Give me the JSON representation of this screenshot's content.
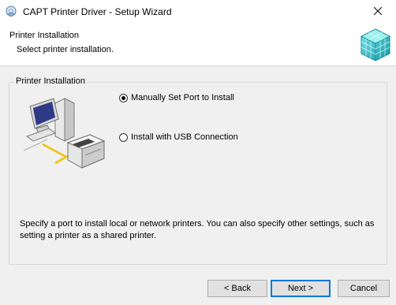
{
  "window": {
    "title": "CAPT Printer Driver - Setup Wizard",
    "title_icon": "setup-disc-icon",
    "close_icon": "close-icon"
  },
  "header": {
    "title": "Printer Installation",
    "subtitle": "Select printer installation.",
    "logo_icon": "cube-stack-logo-icon",
    "logo_color": "#1fb8c0"
  },
  "group": {
    "label": "Printer Installation",
    "illustration_icon": "computer-and-printer-icon"
  },
  "options": [
    {
      "label": "Manually Set Port to Install",
      "selected": true
    },
    {
      "label": "Install with USB Connection",
      "selected": false
    }
  ],
  "description": "Specify a port to install local or network printers. You can also specify other settings, such as setting a printer as a shared printer.",
  "buttons": {
    "back": "< Back",
    "next": "Next >",
    "cancel": "Cancel"
  },
  "colors": {
    "focus_border": "#0078d7",
    "dialog_background": "#f0f0f0"
  }
}
